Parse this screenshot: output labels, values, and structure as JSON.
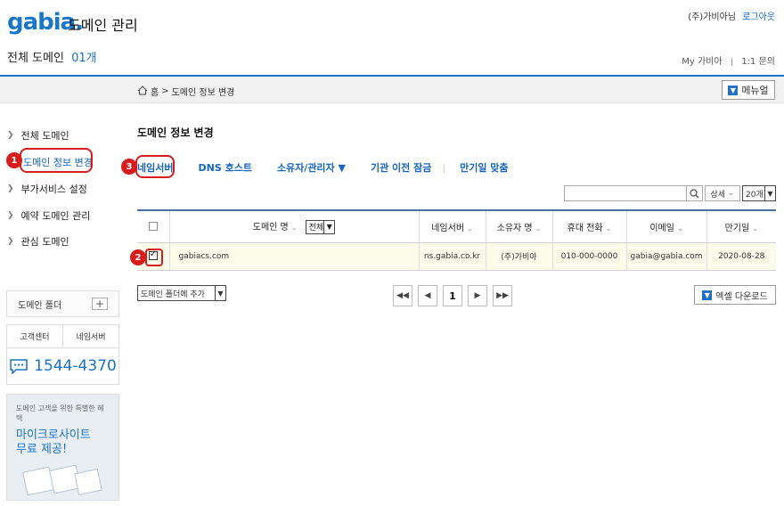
{
  "header": {
    "logo": "gabia.",
    "title": "도메인 관리",
    "user_name": "(주)가비아님",
    "logout": "로그아웃",
    "domain_count_label": "전체 도메인",
    "domain_count": "01개",
    "link_my": "My 가비아",
    "link_sep": "|",
    "link_inquiry": "1:1 문의"
  },
  "breadcrumb": {
    "home": "홈",
    "sep": ">",
    "current": "도메인 정보 변경",
    "menu_label": "메뉴얼"
  },
  "sidebar": {
    "items": [
      {
        "label": "전체 도메인"
      },
      {
        "label": "도메인 정보 변경"
      },
      {
        "label": "부가서비스 설정"
      },
      {
        "label": "예약 도메인 관리"
      },
      {
        "label": "관심 도메인"
      }
    ],
    "folder_label": "도메인 폴더",
    "support_tab_1": "고객센터",
    "support_tab_2": "네임서버",
    "phone": "1544-4370",
    "promo_small": "도메인 고객을 위한 특별한 혜택",
    "promo_big_1": "마이크로사이트",
    "promo_big_2": "무료 제공!"
  },
  "main": {
    "title": "도메인 정보 변경",
    "tabs": [
      {
        "label": "네임서버"
      },
      {
        "label": "DNS 호스트"
      },
      {
        "label": "소유자/관리자 ▼"
      },
      {
        "label": "기관 이전 잠금"
      },
      {
        "label": "만기일 맞춤"
      }
    ],
    "tab_divider": "|",
    "detail_label": "상세",
    "count_select": "20개",
    "filter_value": "전체",
    "columns": [
      "도메인 명",
      "네임서버",
      "소유자 명",
      "휴대 전화",
      "이메일",
      "만기일"
    ],
    "rows": [
      {
        "domain": "gabiacs.com",
        "ns": "ns.gabia.co.kr",
        "owner": "(주)가비아",
        "phone": "010-000-0000",
        "email": "gabia@gabia.com",
        "expire": "2020-08-28"
      }
    ],
    "folder_add": "도메인 폴더에 추가",
    "current_page": "1",
    "excel_label": "엑셀 다운로드"
  },
  "annotations": {
    "badge_1": "1",
    "badge_2": "2",
    "badge_3": "3"
  },
  "colors": {
    "accent": "#1a73c6",
    "highlight": "#d81b1b",
    "row_bg": "#fdfbe9"
  }
}
